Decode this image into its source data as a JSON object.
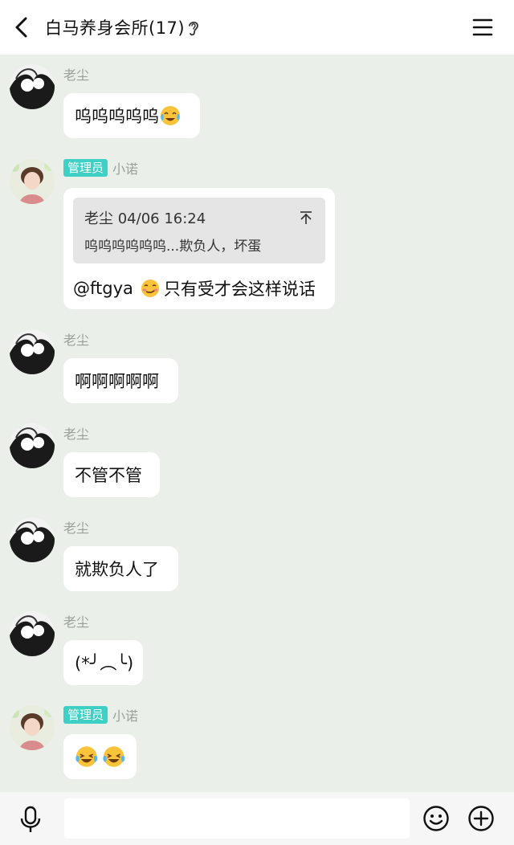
{
  "header": {
    "title": "白马养身会所(17)"
  },
  "messages": [
    {
      "sender": "老尘",
      "text": "呜呜呜呜呜"
    },
    {
      "badge": "管理员",
      "sender": "小诺",
      "quote": {
        "head": "老尘 04/06 16:24",
        "text": "呜呜呜呜呜呜...欺负人，坏蛋"
      },
      "mention": "@ftgya",
      "reply": "只有受才会这样说话"
    },
    {
      "sender": "老尘",
      "text": "啊啊啊啊啊"
    },
    {
      "sender": "老尘",
      "text": "不管不管"
    },
    {
      "sender": "老尘",
      "text": "就欺负人了"
    },
    {
      "sender": "老尘",
      "text": "(*╯︵╰)"
    },
    {
      "badge": "管理员",
      "sender": "小诺"
    }
  ],
  "input": {
    "placeholder": ""
  },
  "colors": {
    "chat_bg": "#eaefea",
    "admin_badge": "#3ed0c4",
    "bubble": "#ffffff",
    "name": "#9aa09a"
  }
}
